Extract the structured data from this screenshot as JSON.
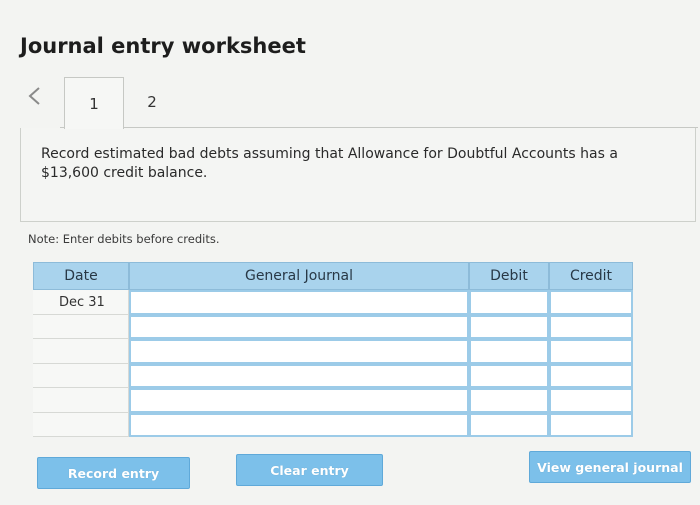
{
  "page": {
    "title": "Journal entry worksheet"
  },
  "tabs": [
    {
      "label": "1",
      "active": true
    },
    {
      "label": "2",
      "active": false
    }
  ],
  "instruction": {
    "text": "Record estimated bad debts assuming that Allowance for Doubtful Accounts has a $13,600 credit balance."
  },
  "note": "Note: Enter debits before credits.",
  "journal": {
    "headers": {
      "date": "Date",
      "general_journal": "General Journal",
      "debit": "Debit",
      "credit": "Credit"
    },
    "rows": [
      {
        "date": "Dec 31",
        "account": "",
        "debit": "",
        "credit": ""
      },
      {
        "date": "",
        "account": "",
        "debit": "",
        "credit": ""
      },
      {
        "date": "",
        "account": "",
        "debit": "",
        "credit": ""
      },
      {
        "date": "",
        "account": "",
        "debit": "",
        "credit": ""
      },
      {
        "date": "",
        "account": "",
        "debit": "",
        "credit": ""
      },
      {
        "date": "",
        "account": "",
        "debit": "",
        "credit": ""
      }
    ]
  },
  "buttons": {
    "record": "Record entry",
    "clear": "Clear entry",
    "view": "View general journal"
  },
  "colors": {
    "header_blue": "#a9d3ed",
    "button_blue": "#7cc0ea",
    "cell_border_blue": "#9ccbe8"
  }
}
